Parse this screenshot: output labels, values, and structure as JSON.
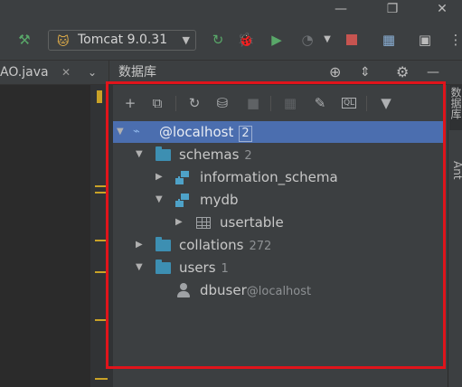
{
  "window": {
    "minimize_glyph": "—",
    "restore_glyph": "❐",
    "close_glyph": "✕"
  },
  "toolbar": {
    "run_config_label": "Tomcat 9.0.31",
    "icons": [
      "hammer-icon",
      "rerun-icon",
      "debug-icon",
      "coverage-icon",
      "profile-icon",
      "stop-icon",
      "project-structure-icon",
      "presentation-icon"
    ]
  },
  "tabs": {
    "file_tab_label": "AO.java",
    "file_tab_close": "✕",
    "panel_title": "数据库"
  },
  "right_strip": {
    "tab1": "数据库",
    "tab2": "Ant"
  },
  "tree": {
    "root": {
      "label": "@localhost",
      "count": "2"
    },
    "schemas": {
      "label": "schemas",
      "count": "2"
    },
    "information_schema": {
      "label": "information_schema"
    },
    "mydb": {
      "label": "mydb"
    },
    "usertable": {
      "label": "usertable"
    },
    "collations": {
      "label": "collations",
      "count": "272"
    },
    "users": {
      "label": "users",
      "count": "1"
    },
    "dbuser": {
      "label": "dbuser",
      "host": "@localhost"
    }
  },
  "colors": {
    "selection": "#4b6eaf",
    "highlight_border": "#e0141b",
    "folder": "#3d8fb2",
    "green_icon": "#59a869",
    "stop_red": "#c75450"
  }
}
